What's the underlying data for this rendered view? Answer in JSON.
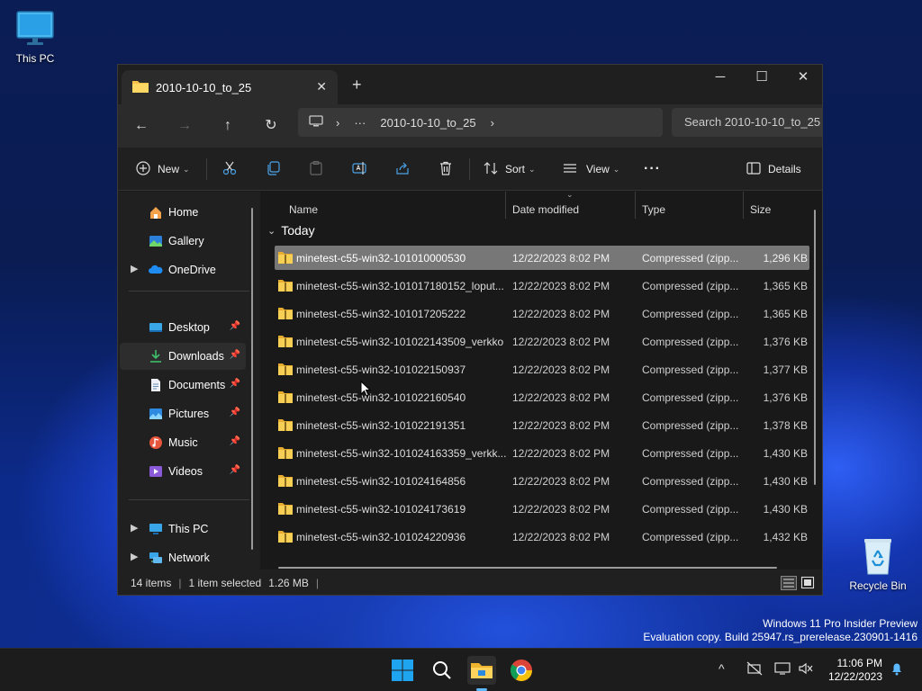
{
  "desktop": {
    "icons": [
      {
        "label": "This PC"
      },
      {
        "label": "Recycle Bin"
      }
    ],
    "watermark": {
      "line1": "Windows 11 Pro Insider Preview",
      "line2": "Evaluation copy. Build 25947.rs_prerelease.230901-1416"
    }
  },
  "window": {
    "tab_title": "2010-10-10_to_25",
    "tab_close": "✕",
    "new_tab": "+",
    "controls": {
      "minimize": "─",
      "maximize": "☐",
      "close": "✕"
    },
    "nav": {
      "back": "←",
      "forward": "→",
      "up": "↑",
      "refresh": "↻"
    },
    "address": {
      "ellipsis": "···",
      "folder": "2010-10-10_to_25",
      "sep1": "›",
      "sep2": "›"
    },
    "search_placeholder": "Search 2010-10-10_to_25",
    "toolbar": {
      "new_label": "New",
      "sort_label": "Sort",
      "view_label": "View",
      "more_label": "···",
      "details_label": "Details"
    },
    "sidebar": {
      "home": "Home",
      "gallery": "Gallery",
      "onedrive": "OneDrive",
      "desktop": "Desktop",
      "downloads": "Downloads",
      "documents": "Documents",
      "pictures": "Pictures",
      "music": "Music",
      "videos": "Videos",
      "thispc": "This PC",
      "network": "Network"
    },
    "columns": {
      "name": "Name",
      "date": "Date modified",
      "type": "Type",
      "size": "Size"
    },
    "group_label": "Today",
    "files": [
      {
        "name": "minetest-c55-win32-101010000530",
        "date": "12/22/2023 8:02 PM",
        "type": "Compressed (zipp...",
        "size": "1,296 KB"
      },
      {
        "name": "minetest-c55-win32-101017180152_loput...",
        "date": "12/22/2023 8:02 PM",
        "type": "Compressed (zipp...",
        "size": "1,365 KB"
      },
      {
        "name": "minetest-c55-win32-101017205222",
        "date": "12/22/2023 8:02 PM",
        "type": "Compressed (zipp...",
        "size": "1,365 KB"
      },
      {
        "name": "minetest-c55-win32-101022143509_verkko",
        "date": "12/22/2023 8:02 PM",
        "type": "Compressed (zipp...",
        "size": "1,376 KB"
      },
      {
        "name": "minetest-c55-win32-101022150937",
        "date": "12/22/2023 8:02 PM",
        "type": "Compressed (zipp...",
        "size": "1,377 KB"
      },
      {
        "name": "minetest-c55-win32-101022160540",
        "date": "12/22/2023 8:02 PM",
        "type": "Compressed (zipp...",
        "size": "1,376 KB"
      },
      {
        "name": "minetest-c55-win32-101022191351",
        "date": "12/22/2023 8:02 PM",
        "type": "Compressed (zipp...",
        "size": "1,378 KB"
      },
      {
        "name": "minetest-c55-win32-101024163359_verkk...",
        "date": "12/22/2023 8:02 PM",
        "type": "Compressed (zipp...",
        "size": "1,430 KB"
      },
      {
        "name": "minetest-c55-win32-101024164856",
        "date": "12/22/2023 8:02 PM",
        "type": "Compressed (zipp...",
        "size": "1,430 KB"
      },
      {
        "name": "minetest-c55-win32-101024173619",
        "date": "12/22/2023 8:02 PM",
        "type": "Compressed (zipp...",
        "size": "1,430 KB"
      },
      {
        "name": "minetest-c55-win32-101024220936",
        "date": "12/22/2023 8:02 PM",
        "type": "Compressed (zipp...",
        "size": "1,432 KB"
      }
    ],
    "status": {
      "items": "14 items",
      "selected": "1 item selected",
      "size": "1.26 MB",
      "sep": "|"
    }
  },
  "taskbar": {
    "time": "11:06 PM",
    "date": "12/22/2023",
    "tray_chevron": "^"
  }
}
